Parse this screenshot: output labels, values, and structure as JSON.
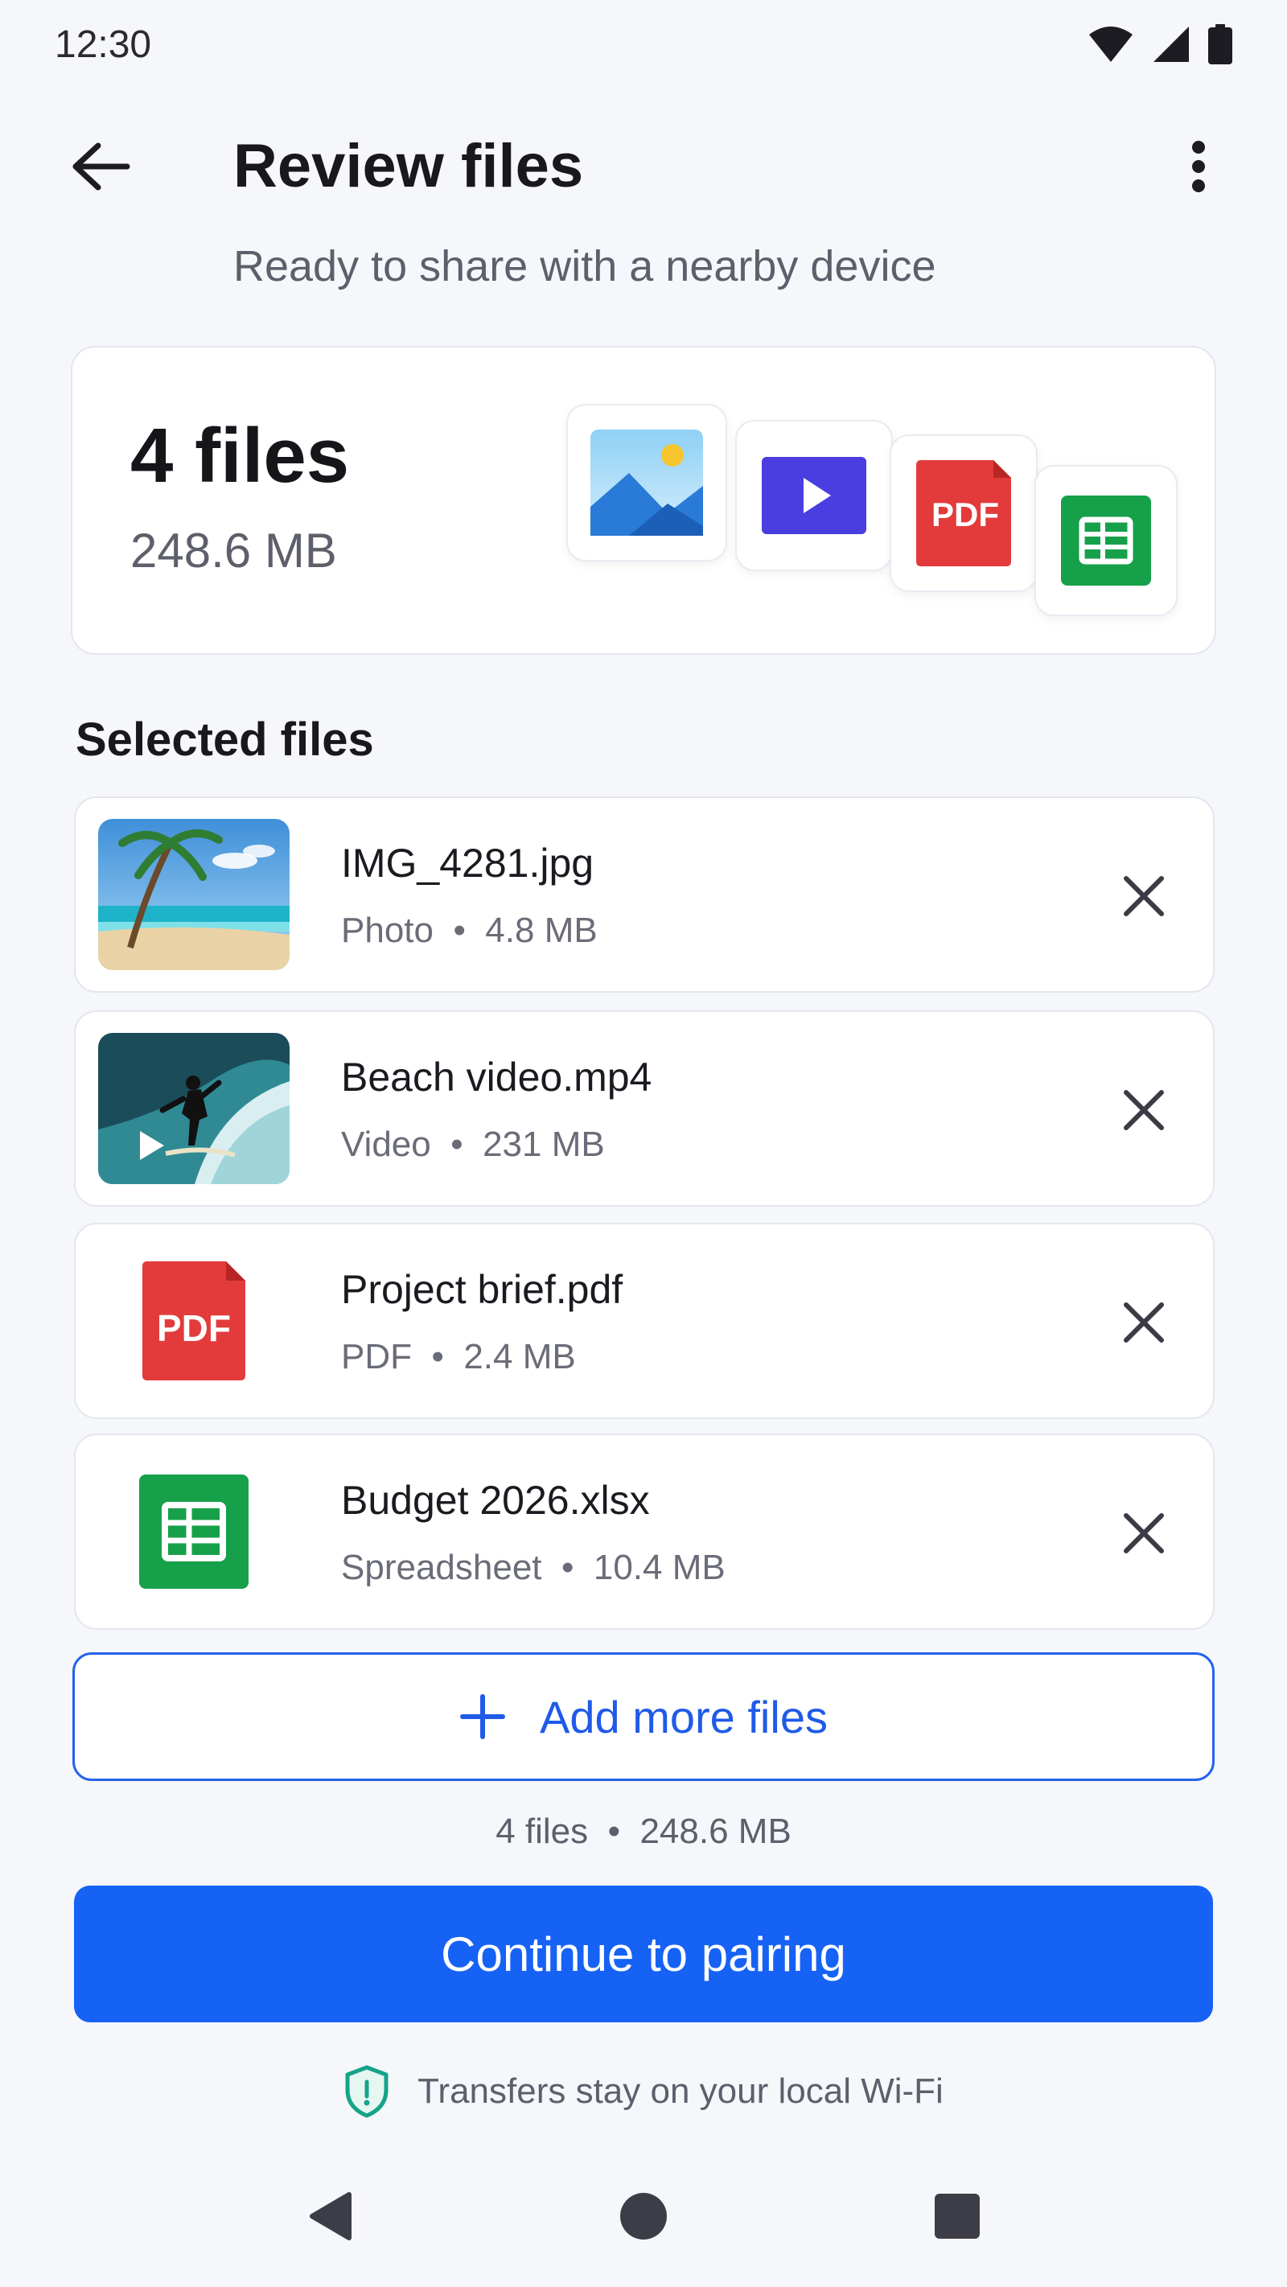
{
  "status_bar": {
    "time": "12:30"
  },
  "app_bar": {
    "title": "Review files"
  },
  "subtitle": "Ready to share with a nearby device",
  "summary": {
    "count": "4 files",
    "size": "248.6 MB"
  },
  "section_title": "Selected files",
  "files": [
    {
      "name": "IMG_4281.jpg",
      "type": "Photo",
      "size": "4.8 MB"
    },
    {
      "name": "Beach video.mp4",
      "type": "Video",
      "size": "231 MB"
    },
    {
      "name": "Project brief.pdf",
      "type": "PDF",
      "size": "2.4 MB"
    },
    {
      "name": "Budget 2026.xlsx",
      "type": "Spreadsheet",
      "size": "10.4 MB"
    }
  ],
  "meta_separator": "•",
  "pdf_badge": "PDF",
  "add_more_label": "Add more files",
  "totals": {
    "count": "4 files",
    "size": "248.6 MB"
  },
  "continue_label": "Continue to pairing",
  "security_note": "Transfers stay on your local Wi-Fi",
  "colors": {
    "primary": "#1662f5",
    "pdf_red": "#e33b3b",
    "sheet_green": "#17a04a",
    "video_purple": "#4b3ee0",
    "shield_teal": "#16a389"
  }
}
